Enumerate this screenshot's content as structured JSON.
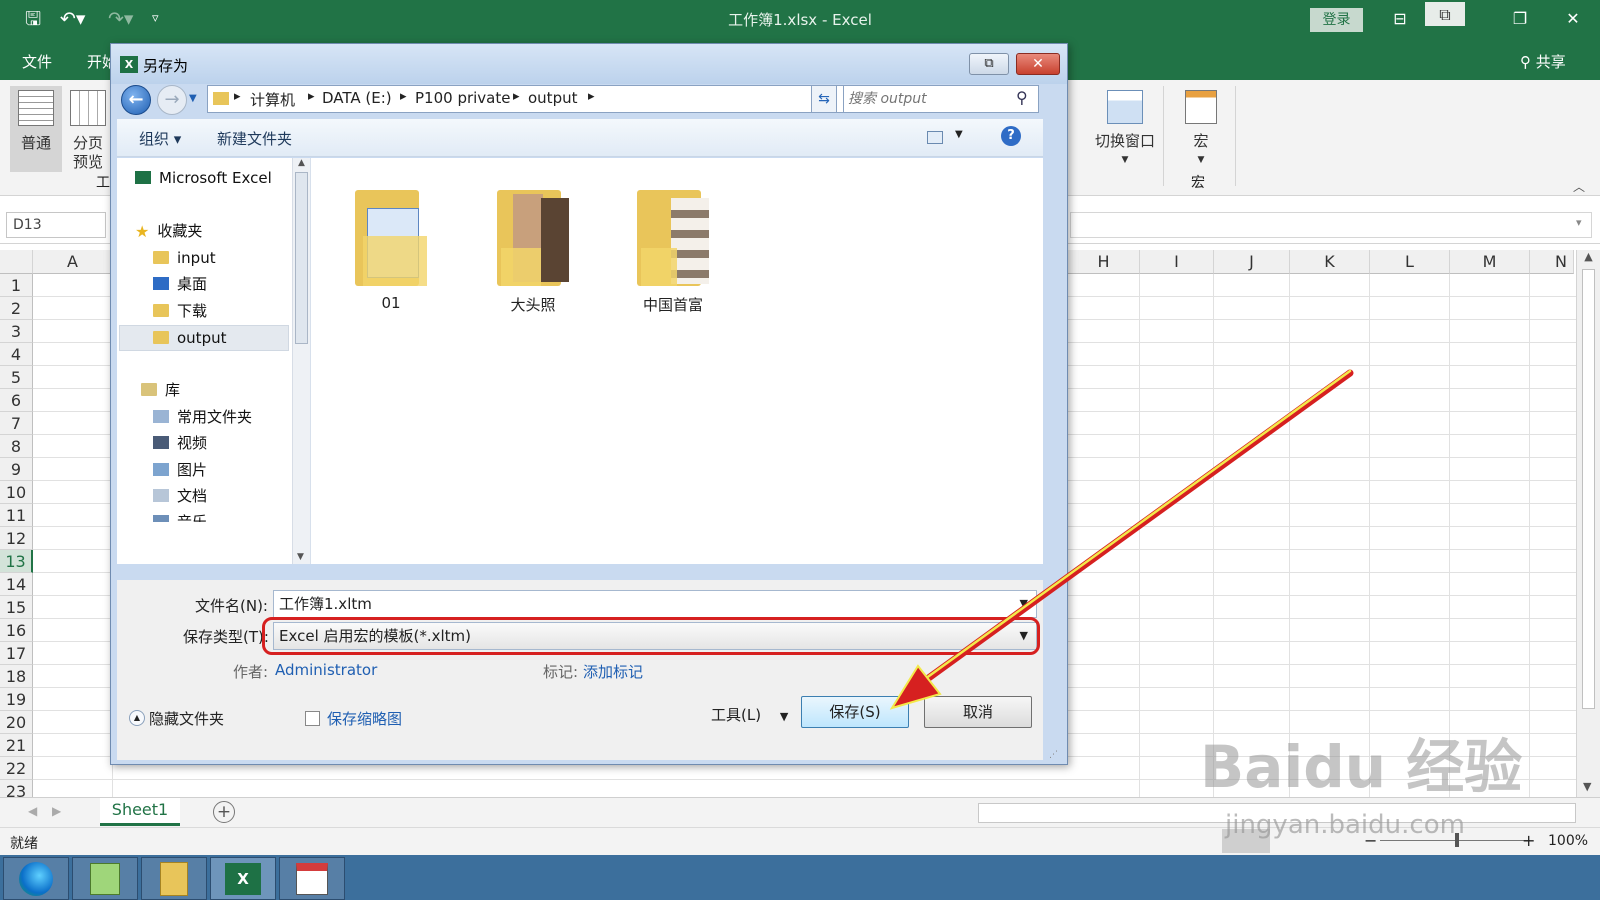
{
  "excel": {
    "window_title": "工作簿1.xlsx - Excel",
    "login": "登录",
    "share": "共享",
    "tab_file": "文件",
    "tab_home_partial": "开始",
    "ribbon": {
      "normal": "普通",
      "page_break_1": "分页",
      "page_break_2": "预览",
      "group_partial": "工",
      "switch_window": "切换窗口",
      "macro": "宏",
      "macro_group": "宏"
    },
    "name_box": "D13",
    "columns": [
      "A",
      "H",
      "I",
      "J",
      "K",
      "L",
      "M",
      "N"
    ],
    "rows": [
      "1",
      "2",
      "3",
      "4",
      "5",
      "6",
      "7",
      "8",
      "9",
      "10",
      "11",
      "12",
      "13",
      "14",
      "15",
      "16",
      "17",
      "18",
      "19",
      "20",
      "21",
      "22",
      "23"
    ],
    "selected_row": "13",
    "sheet_tab": "Sheet1",
    "status": "就绪",
    "zoom": "100%"
  },
  "dialog": {
    "title": "另存为",
    "breadcrumb": [
      "计算机",
      "DATA (E:)",
      "P100 private",
      "output"
    ],
    "search_placeholder": "搜索 output",
    "organize": "组织 ▾",
    "new_folder": "新建文件夹",
    "nav": {
      "app": "Microsoft Excel",
      "favorites": "收藏夹",
      "fav_items": [
        "input",
        "桌面",
        "下载",
        "output"
      ],
      "library": "库",
      "lib_items": [
        "常用文件夹",
        "视频",
        "图片",
        "文档",
        "音乐"
      ]
    },
    "folders": [
      "01",
      "大头照",
      "中国首富"
    ],
    "filename_label": "文件名(N):",
    "filename_value": "工作簿1.xltm",
    "filetype_label": "保存类型(T):",
    "filetype_value": "Excel 启用宏的模板(*.xltm)",
    "author_label": "作者:",
    "author_value": "Administrator",
    "tags_label": "标记:",
    "tags_value": "添加标记",
    "thumbnail_label": "保存缩略图",
    "hide_folders": "隐藏文件夹",
    "tools": "工具(L)",
    "save": "保存(S)",
    "cancel": "取消"
  },
  "watermark": {
    "brand": "Baidu 经验",
    "url": "jingyan.baidu.com"
  },
  "colors": {
    "excel_green": "#217346",
    "highlight_red": "#d62020",
    "arrow_yellow": "#f3e94a"
  }
}
